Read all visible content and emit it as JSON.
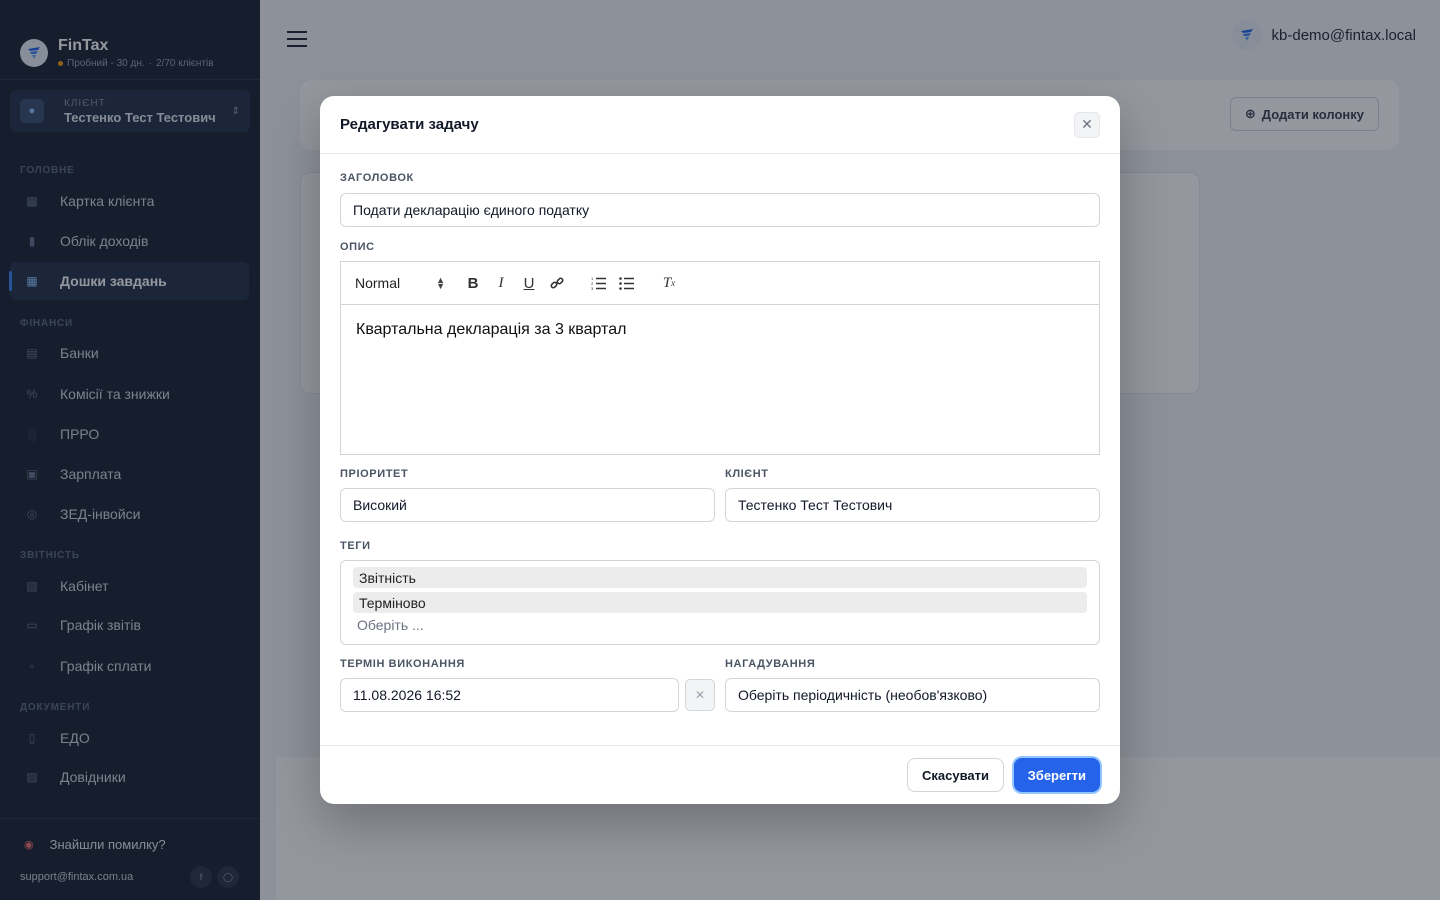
{
  "brand": {
    "name": "FinTax",
    "plan": "Пробний - 30 дн.",
    "clients": "2/70 клієнтів"
  },
  "client_selector": {
    "label": "КЛІЄНТ",
    "name": "Тестенко Тест Тестович"
  },
  "nav": {
    "section_main": "ГОЛОВНЕ",
    "client_card": "Картка клієнта",
    "income": "Облік доходів",
    "boards": "Дошки завдань",
    "section_finance": "ФІНАНСИ",
    "banks": "Банки",
    "commissions": "Комісії та знижки",
    "prro": "ПРРО",
    "salary": "Зарплата",
    "zed": "ЗЕД-інвойси",
    "section_reports": "ЗВІТНІСТЬ",
    "cabinet": "Кабінет",
    "report_schedule": "Графік звітів",
    "payment_schedule": "Графік сплати",
    "section_docs": "ДОКУМЕНТИ",
    "edo": "ЕДО",
    "references": "Довідники"
  },
  "sidebar_footer": {
    "bug": "Знайшли помилку?",
    "email": "support@fintax.com.ua"
  },
  "topbar": {
    "user": "kb-demo@fintax.local"
  },
  "board": {
    "add_column": "Додати колонку"
  },
  "modal": {
    "title": "Редагувати задачу",
    "title_label": "ЗАГОЛОВОК",
    "title_value": "Подати декларацію єдиного податку",
    "description_label": "ОПИС",
    "editor_format": "Normal",
    "description_text": "Квартальна декларація за 3 квартал",
    "priority_label": "ПРІОРИТЕТ",
    "priority_value": "Високий",
    "client_label": "КЛІЄНТ",
    "client_value": "Тестенко Тест Тестович",
    "tags_label": "ТЕГИ",
    "tags": [
      "Звітність",
      "Терміново"
    ],
    "tags_placeholder": "Оберіть ...",
    "due_label": "ТЕРМІН ВИКОНАННЯ",
    "due_value": "11.08.2026 16:52",
    "reminder_label": "НАГАДУВАННЯ",
    "reminder_value": "Оберіть періодичність (необов'язково)",
    "cancel": "Скасувати",
    "save": "Зберегти"
  },
  "colors": {
    "sidebar": "#1b2333",
    "accent": "#2563eb",
    "overlay": "rgba(17,24,39,0.45)"
  }
}
